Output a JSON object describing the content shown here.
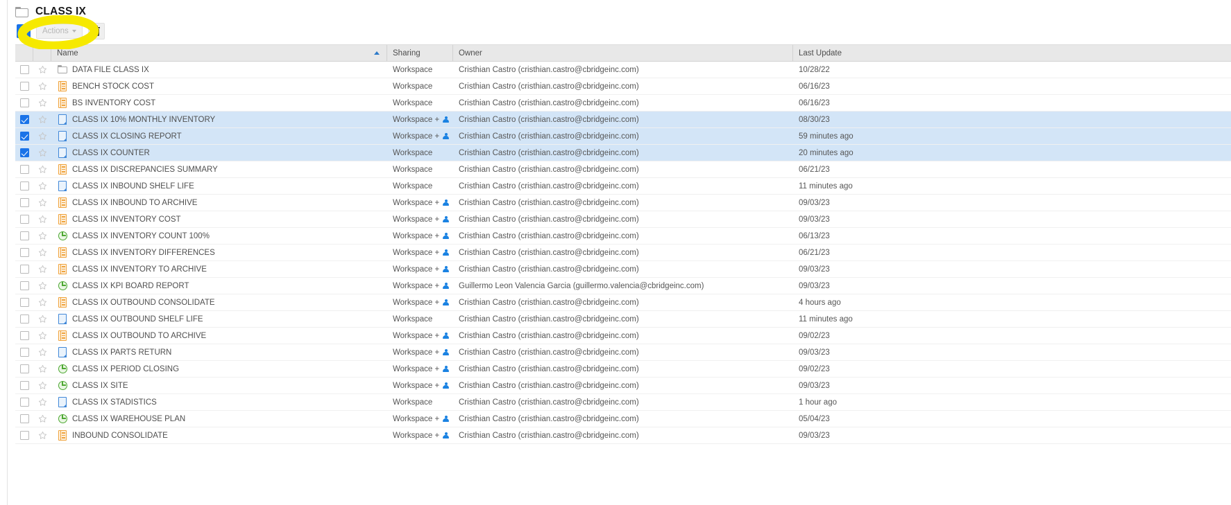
{
  "header": {
    "title": "CLASS IX",
    "folder_icon": "folder-icon"
  },
  "toolbar": {
    "select_all_state": "indeterminate",
    "actions_label": "Actions",
    "delete_icon": "trash-icon",
    "highlight_color": "#f6e900"
  },
  "columns": {
    "check": "",
    "star": "",
    "name": "Name",
    "sharing": "Sharing",
    "owner": "Owner",
    "last_update": "Last Update",
    "sort_column": "Name",
    "sort_direction": "asc"
  },
  "owners": {
    "cristhian": "Cristhian Castro (cristhian.castro@cbridgeinc.com)",
    "guillermo": "Guillermo Leon Valencia Garcia (guillermo.valencia@cbridgeinc.com)"
  },
  "sharing_labels": {
    "workspace": "Workspace",
    "workspace_plus": "Workspace +"
  },
  "colors": {
    "selected_row": "#d3e5f7",
    "checkbox_accent": "#1a73e8",
    "report_icon": "#f0a33c",
    "doc_icon": "#3f87d8",
    "pie_icon": "#4da832",
    "person_icon": "#1a82e2",
    "header_bg": "#e8e8e8"
  },
  "rows": [
    {
      "name": "DATA FILE CLASS IX",
      "icon": "folder",
      "selected": false,
      "starred": false,
      "sharing": "Workspace",
      "shared_user": false,
      "owner": "Cristhian Castro (cristhian.castro@cbridgeinc.com)",
      "last_update": "10/28/22"
    },
    {
      "name": "BENCH STOCK COST",
      "icon": "report",
      "selected": false,
      "starred": false,
      "sharing": "Workspace",
      "shared_user": false,
      "owner": "Cristhian Castro (cristhian.castro@cbridgeinc.com)",
      "last_update": "06/16/23"
    },
    {
      "name": "BS INVENTORY COST",
      "icon": "report",
      "selected": false,
      "starred": false,
      "sharing": "Workspace",
      "shared_user": false,
      "owner": "Cristhian Castro (cristhian.castro@cbridgeinc.com)",
      "last_update": "06/16/23"
    },
    {
      "name": "CLASS IX 10% MONTHLY INVENTORY",
      "icon": "doc",
      "selected": true,
      "starred": false,
      "sharing": "Workspace +",
      "shared_user": true,
      "owner": "Cristhian Castro (cristhian.castro@cbridgeinc.com)",
      "last_update": "08/30/23"
    },
    {
      "name": "CLASS IX CLOSING REPORT",
      "icon": "doc",
      "selected": true,
      "starred": false,
      "sharing": "Workspace +",
      "shared_user": true,
      "owner": "Cristhian Castro (cristhian.castro@cbridgeinc.com)",
      "last_update": "59 minutes ago"
    },
    {
      "name": "CLASS IX COUNTER",
      "icon": "doc",
      "selected": true,
      "starred": false,
      "sharing": "Workspace",
      "shared_user": false,
      "owner": "Cristhian Castro (cristhian.castro@cbridgeinc.com)",
      "last_update": "20 minutes ago"
    },
    {
      "name": "CLASS IX DISCREPANCIES SUMMARY",
      "icon": "report",
      "selected": false,
      "starred": false,
      "sharing": "Workspace",
      "shared_user": false,
      "owner": "Cristhian Castro (cristhian.castro@cbridgeinc.com)",
      "last_update": "06/21/23"
    },
    {
      "name": "CLASS IX INBOUND SHELF LIFE",
      "icon": "doc",
      "selected": false,
      "starred": false,
      "sharing": "Workspace",
      "shared_user": false,
      "owner": "Cristhian Castro (cristhian.castro@cbridgeinc.com)",
      "last_update": "11 minutes ago"
    },
    {
      "name": "CLASS IX INBOUND TO ARCHIVE",
      "icon": "report",
      "selected": false,
      "starred": false,
      "sharing": "Workspace +",
      "shared_user": true,
      "owner": "Cristhian Castro (cristhian.castro@cbridgeinc.com)",
      "last_update": "09/03/23"
    },
    {
      "name": "CLASS IX INVENTORY COST",
      "icon": "report",
      "selected": false,
      "starred": false,
      "sharing": "Workspace +",
      "shared_user": true,
      "owner": "Cristhian Castro (cristhian.castro@cbridgeinc.com)",
      "last_update": "09/03/23"
    },
    {
      "name": "CLASS IX INVENTORY COUNT 100%",
      "icon": "pie",
      "selected": false,
      "starred": false,
      "sharing": "Workspace +",
      "shared_user": true,
      "owner": "Cristhian Castro (cristhian.castro@cbridgeinc.com)",
      "last_update": "06/13/23"
    },
    {
      "name": "CLASS IX INVENTORY DIFFERENCES",
      "icon": "report",
      "selected": false,
      "starred": false,
      "sharing": "Workspace +",
      "shared_user": true,
      "owner": "Cristhian Castro (cristhian.castro@cbridgeinc.com)",
      "last_update": "06/21/23"
    },
    {
      "name": "CLASS IX INVENTORY TO ARCHIVE",
      "icon": "report",
      "selected": false,
      "starred": false,
      "sharing": "Workspace +",
      "shared_user": true,
      "owner": "Cristhian Castro (cristhian.castro@cbridgeinc.com)",
      "last_update": "09/03/23"
    },
    {
      "name": "CLASS IX KPI BOARD REPORT",
      "icon": "pie",
      "selected": false,
      "starred": false,
      "sharing": "Workspace +",
      "shared_user": true,
      "owner": "Guillermo Leon Valencia Garcia (guillermo.valencia@cbridgeinc.com)",
      "last_update": "09/03/23"
    },
    {
      "name": "CLASS IX OUTBOUND CONSOLIDATE",
      "icon": "report",
      "selected": false,
      "starred": false,
      "sharing": "Workspace +",
      "shared_user": true,
      "owner": "Cristhian Castro (cristhian.castro@cbridgeinc.com)",
      "last_update": "4 hours ago"
    },
    {
      "name": "CLASS IX OUTBOUND SHELF LIFE",
      "icon": "doc",
      "selected": false,
      "starred": false,
      "sharing": "Workspace",
      "shared_user": false,
      "owner": "Cristhian Castro (cristhian.castro@cbridgeinc.com)",
      "last_update": "11 minutes ago"
    },
    {
      "name": "CLASS IX OUTBOUND TO ARCHIVE",
      "icon": "report",
      "selected": false,
      "starred": false,
      "sharing": "Workspace +",
      "shared_user": true,
      "owner": "Cristhian Castro (cristhian.castro@cbridgeinc.com)",
      "last_update": "09/02/23"
    },
    {
      "name": "CLASS IX PARTS RETURN",
      "icon": "doc",
      "selected": false,
      "starred": false,
      "sharing": "Workspace +",
      "shared_user": true,
      "owner": "Cristhian Castro (cristhian.castro@cbridgeinc.com)",
      "last_update": "09/03/23"
    },
    {
      "name": "CLASS IX PERIOD CLOSING",
      "icon": "pie",
      "selected": false,
      "starred": false,
      "sharing": "Workspace +",
      "shared_user": true,
      "owner": "Cristhian Castro (cristhian.castro@cbridgeinc.com)",
      "last_update": "09/02/23"
    },
    {
      "name": "CLASS IX SITE",
      "icon": "pie",
      "selected": false,
      "starred": false,
      "sharing": "Workspace +",
      "shared_user": true,
      "owner": "Cristhian Castro (cristhian.castro@cbridgeinc.com)",
      "last_update": "09/03/23"
    },
    {
      "name": "CLASS IX STADISTICS",
      "icon": "doc",
      "selected": false,
      "starred": false,
      "sharing": "Workspace",
      "shared_user": false,
      "owner": "Cristhian Castro (cristhian.castro@cbridgeinc.com)",
      "last_update": "1 hour ago"
    },
    {
      "name": "CLASS IX WAREHOUSE PLAN",
      "icon": "pie",
      "selected": false,
      "starred": false,
      "sharing": "Workspace +",
      "shared_user": true,
      "owner": "Cristhian Castro (cristhian.castro@cbridgeinc.com)",
      "last_update": "05/04/23"
    },
    {
      "name": "INBOUND CONSOLIDATE",
      "icon": "report",
      "selected": false,
      "starred": false,
      "sharing": "Workspace +",
      "shared_user": true,
      "owner": "Cristhian Castro (cristhian.castro@cbridgeinc.com)",
      "last_update": "09/03/23"
    }
  ]
}
